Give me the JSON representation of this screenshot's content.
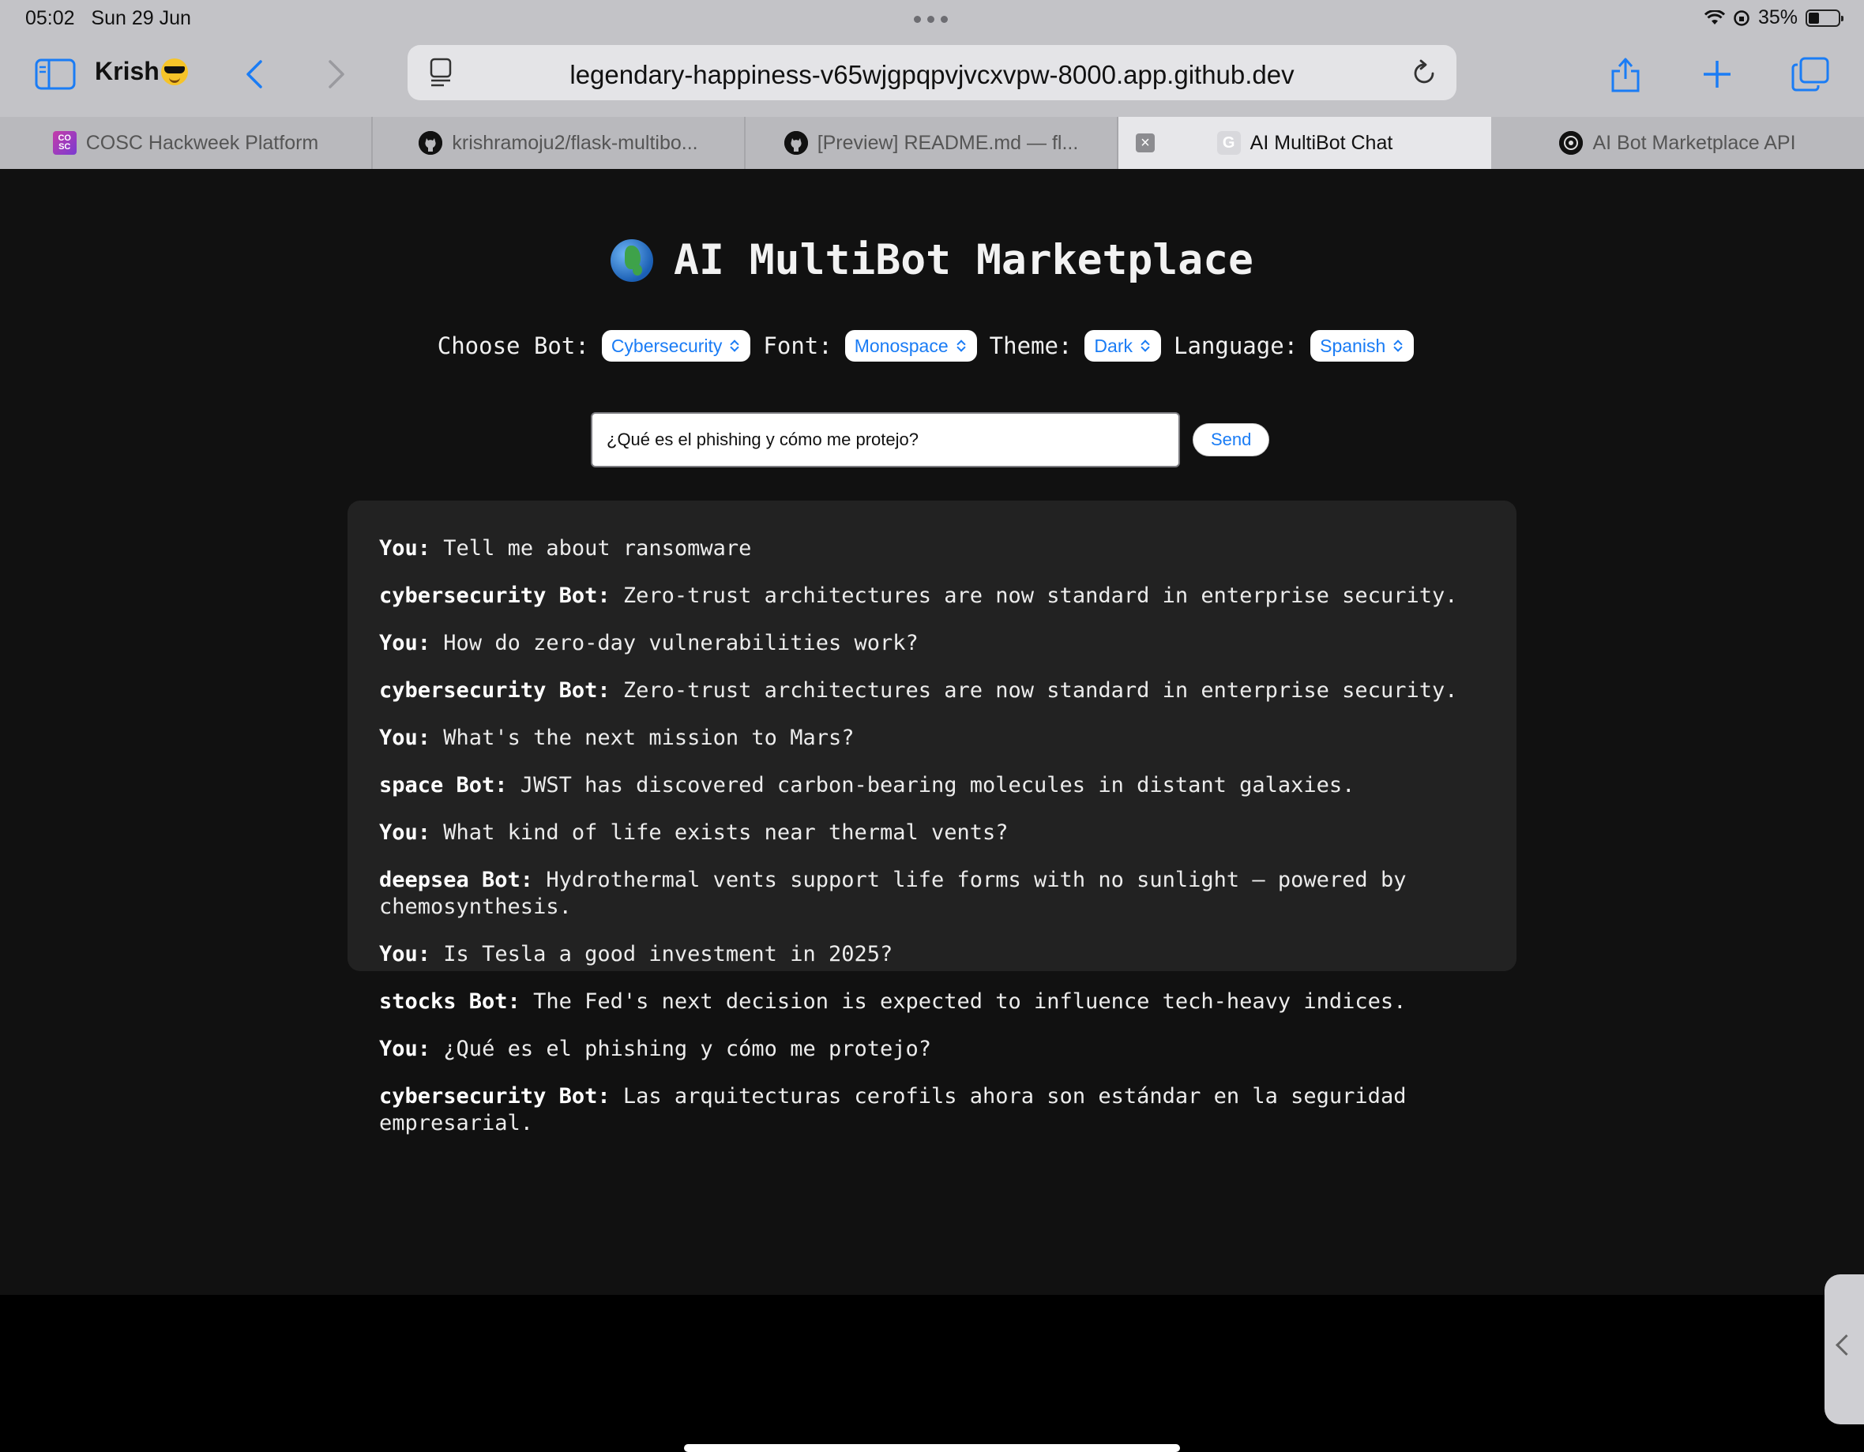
{
  "status_bar": {
    "time": "05:02",
    "date": "Sun 29 Jun",
    "battery_percent": "35%",
    "battery_level": 0.35
  },
  "toolbar": {
    "profile_name": "Krish",
    "url": "legendary-happiness-v65wjgpqpvjvcxvpw-8000.app.github.dev",
    "accent_color": "#1a7cf5"
  },
  "tabs": [
    {
      "title": "COSC Hackweek Platform",
      "favicon": "cosc-favicon",
      "favicon_text": "CO SC"
    },
    {
      "title": "krishramoju2/flask-multibo...",
      "favicon": "github-icon"
    },
    {
      "title": "[Preview] README.md — fl...",
      "favicon": "github-icon"
    },
    {
      "title": "AI MultiBot Chat",
      "favicon": "g-favicon",
      "favicon_text": "G",
      "active": true
    },
    {
      "title": "AI Bot Marketplace API",
      "favicon": "openai-icon"
    }
  ],
  "page": {
    "title": "AI MultiBot Marketplace",
    "controls": {
      "bot_label": "Choose Bot:",
      "bot_value": "Cybersecurity",
      "font_label": "Font:",
      "font_value": "Monospace",
      "theme_label": "Theme:",
      "theme_value": "Dark",
      "language_label": "Language:",
      "language_value": "Spanish"
    },
    "input": {
      "value": "¿Qué es el phishing y cómo me protejo?"
    },
    "send_label": "Send",
    "messages": [
      {
        "sender": "You:",
        "text": "Tell me about ransomware"
      },
      {
        "sender": "cybersecurity Bot:",
        "text": "Zero-trust architectures are now standard in enterprise security."
      },
      {
        "sender": "You:",
        "text": "How do zero-day vulnerabilities work?"
      },
      {
        "sender": "cybersecurity Bot:",
        "text": "Zero-trust architectures are now standard in enterprise security."
      },
      {
        "sender": "You:",
        "text": "What's the next mission to Mars?"
      },
      {
        "sender": "space Bot:",
        "text": "JWST has discovered carbon-bearing molecules in distant galaxies."
      },
      {
        "sender": "You:",
        "text": "What kind of life exists near thermal vents?"
      },
      {
        "sender": "deepsea Bot:",
        "text": "Hydrothermal vents support life forms with no sunlight — powered by\nchemosynthesis."
      },
      {
        "sender": "You:",
        "text": "Is Tesla a good investment in 2025?"
      },
      {
        "sender": "stocks Bot:",
        "text": "The Fed's next decision is expected to influence tech-heavy indices."
      },
      {
        "sender": "You:",
        "text": "¿Qué es el phishing y cómo me protejo?"
      },
      {
        "sender": "cybersecurity Bot:",
        "text": "Las arquitecturas cerofils ahora son estándar en la seguridad\nempresarial."
      }
    ]
  }
}
